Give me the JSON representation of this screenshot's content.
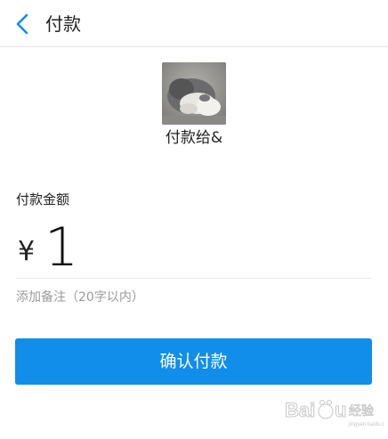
{
  "header": {
    "title": "付款",
    "back_icon": "chevron-left-icon",
    "accent_color": "#108ee9"
  },
  "payee": {
    "text": "付款给&"
  },
  "amount": {
    "label": "付款金额",
    "currency": "¥",
    "value": "1"
  },
  "remark": {
    "placeholder": "添加备注（20字以内）"
  },
  "confirm": {
    "label": "确认付款",
    "color": "#108ee9"
  },
  "watermark": {
    "brand": "Baidu 经验"
  }
}
